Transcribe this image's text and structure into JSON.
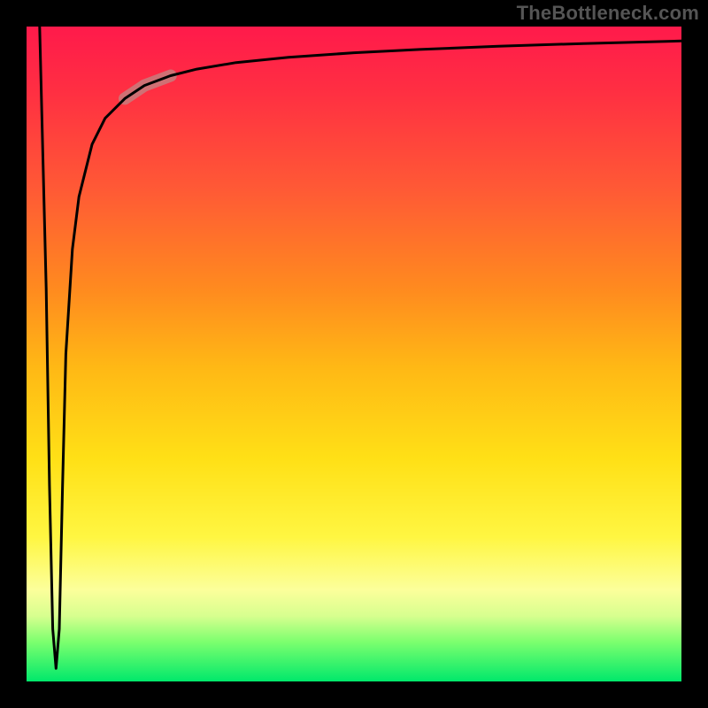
{
  "watermark": "TheBottleneck.com",
  "chart_data": {
    "type": "line",
    "title": "",
    "xlabel": "",
    "ylabel": "",
    "xlim": [
      0,
      100
    ],
    "ylim": [
      0,
      100
    ],
    "grid": false,
    "legend": false,
    "description": "Bottleneck-style curve: a near-vertical drop from the top-left down to a sharp trough near the bottom, then a steep rise that asymptotically flattens near the top as x increases. Background is a vertical red→yellow→green gradient.",
    "series": [
      {
        "name": "bottleneck-curve",
        "x": [
          2,
          3,
          3.5,
          4,
          4.5,
          5,
          5.5,
          6,
          7,
          8,
          10,
          12,
          15,
          18,
          22,
          26,
          32,
          40,
          50,
          60,
          72,
          85,
          100
        ],
        "y": [
          100,
          60,
          30,
          8,
          2,
          8,
          30,
          50,
          66,
          74,
          82,
          86,
          89,
          91,
          92.5,
          93.5,
          94.5,
          95.3,
          96,
          96.5,
          97,
          97.4,
          97.8
        ]
      }
    ],
    "highlight_segment": {
      "x_start": 15,
      "x_end": 22
    },
    "colors": {
      "curve": "#000000",
      "highlight": "#c77d7d",
      "gradient_top": "#ff1a4b",
      "gradient_mid": "#ffe016",
      "gradient_bottom": "#00e86b",
      "frame": "#000000"
    }
  }
}
